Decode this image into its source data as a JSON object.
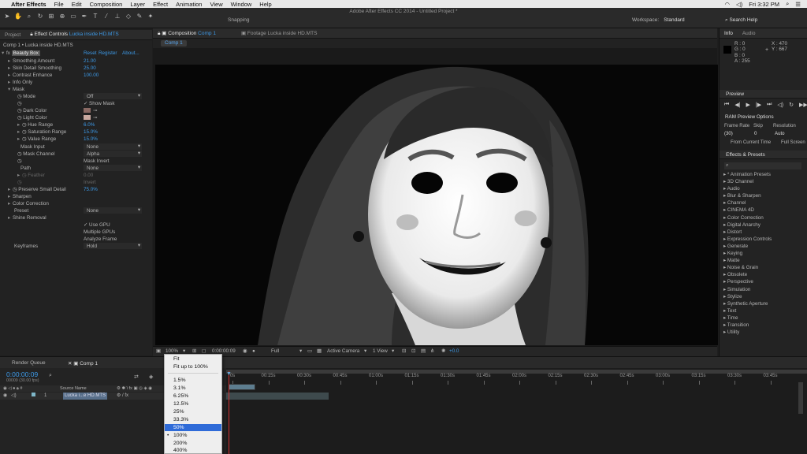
{
  "menubar": {
    "app": "After Effects",
    "items": [
      "File",
      "Edit",
      "Composition",
      "Layer",
      "Effect",
      "Animation",
      "View",
      "Window",
      "Help"
    ],
    "clock": "Fri 3:32 PM"
  },
  "toolbar": {
    "title": "Adobe After Effects CC 2014 - Untitled Project *",
    "snapping": "Snapping",
    "workspace_label": "Workspace:",
    "workspace_value": "Standard",
    "search_help": "Search Help"
  },
  "left_panel": {
    "project_tab": "Project",
    "effect_controls_tab": "Effect Controls",
    "effect_controls_target": "Lucka inside HD.MTS",
    "header": "Comp 1 • Lucka inside HD.MTS",
    "effect_name": "Beauty Box",
    "reset": "Reset",
    "register": "Register",
    "about": "About...",
    "rows": [
      {
        "label": "Smoothing Amount",
        "value": "21.00"
      },
      {
        "label": "Skin Detail Smoothing",
        "value": "25.00"
      },
      {
        "label": "Contrast Enhance",
        "value": "100.00"
      },
      {
        "label": "Info Only",
        "value": ""
      },
      {
        "label": "Mask",
        "value": ""
      },
      {
        "label": "Mode",
        "value": "Off"
      },
      {
        "label": "",
        "value": "✓ Show Mask"
      },
      {
        "label": "Dark Color",
        "value": ""
      },
      {
        "label": "Light Color",
        "value": ""
      },
      {
        "label": "Hue Range",
        "value": "6.0%"
      },
      {
        "label": "Saturation Range",
        "value": "15.0%"
      },
      {
        "label": "Value Range",
        "value": "15.0%"
      },
      {
        "label": "Mask Input",
        "value": "None"
      },
      {
        "label": "Mask Channel",
        "value": "Alpha"
      },
      {
        "label": "",
        "value": "Mask Invert"
      },
      {
        "label": "Path",
        "value": "None"
      },
      {
        "label": "Feather",
        "value": "0.00"
      },
      {
        "label": "",
        "value": "Invert"
      },
      {
        "label": "Preserve Small Detail",
        "value": "75.0%"
      },
      {
        "label": "Sharpen",
        "value": ""
      },
      {
        "label": "Color Correction",
        "value": ""
      },
      {
        "label": "Preset",
        "value": "None"
      },
      {
        "label": "Shine Removal",
        "value": ""
      },
      {
        "label": "",
        "value": "✓ Use GPU"
      },
      {
        "label": "",
        "value": "Multiple GPUs"
      },
      {
        "label": "",
        "value": "Analyze Frame"
      },
      {
        "label": "Keyframes",
        "value": "Hold"
      }
    ]
  },
  "comp_panel": {
    "tab_label": "Composition",
    "tab_comp": "Comp 1",
    "footage_tab": "Footage Lucka inside HD.MTS",
    "comp_pill": "Comp 1",
    "zoom": "100%",
    "timecode": "0:00:00:09",
    "resolution": "Full",
    "camera": "Active Camera",
    "view": "1 View",
    "exposure": "+0.0"
  },
  "info_panel": {
    "tab_info": "Info",
    "tab_audio": "Audio",
    "r": "R : 0",
    "g": "G : 0",
    "b": "B : 0",
    "a": "A : 255",
    "x": "X : 470",
    "y": "Y : 667"
  },
  "preview_panel": {
    "title": "Preview",
    "ram_options": "RAM Preview Options",
    "frame_rate_label": "Frame Rate",
    "skip_label": "Skip",
    "resolution_label": "Resolution",
    "frame_rate": "(30)",
    "skip": "0",
    "resolution": "Auto",
    "from_current": "From Current Time",
    "full_screen": "Full Screen"
  },
  "effects_presets": {
    "title": "Effects & Presets",
    "items": [
      "* Animation Presets",
      "3D Channel",
      "Audio",
      "Blur & Sharpen",
      "Channel",
      "CINEMA 4D",
      "Color Correction",
      "Digital Anarchy",
      "Distort",
      "Expression Controls",
      "Generate",
      "Keying",
      "Matte",
      "Noise & Grain",
      "Obsolete",
      "Perspective",
      "Simulation",
      "Stylize",
      "Synthetic Aperture",
      "Text",
      "Time",
      "Transition",
      "Utility"
    ]
  },
  "timeline": {
    "render_queue": "Render Queue",
    "comp_tab": "Comp 1",
    "timecode": "0:00:00:09",
    "frame_info": "00009 (30.00 fps)",
    "source_name_header": "Source Name",
    "layer_number": "1",
    "layer_name": "Lucka i...e HD.MTS",
    "ruler": [
      "0s",
      "00:15s",
      "00:30s",
      "00:45s",
      "01:00s",
      "01:15s",
      "01:30s",
      "01:45s",
      "02:00s",
      "02:15s",
      "02:30s",
      "02:45s",
      "03:00s",
      "03:15s",
      "03:30s",
      "03:45s"
    ]
  },
  "zoom_menu": {
    "items": [
      "Fit",
      "Fit up to 100%",
      "1.5%",
      "3.1%",
      "6.25%",
      "12.5%",
      "25%",
      "33.3%",
      "50%",
      "100%",
      "200%",
      "400%"
    ],
    "highlighted": "50%",
    "checked": "100%"
  }
}
